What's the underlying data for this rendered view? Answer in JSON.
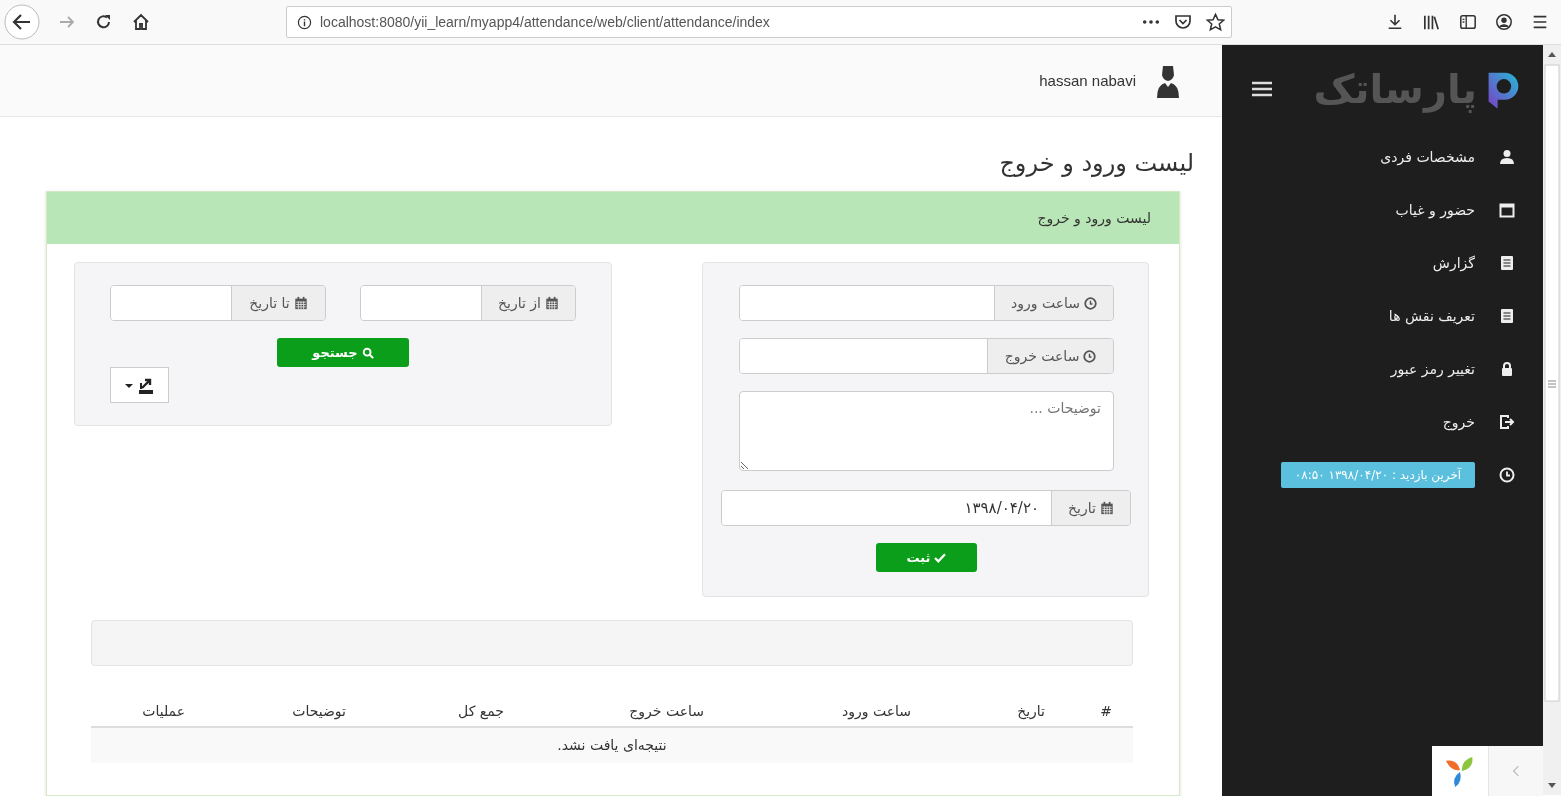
{
  "browser": {
    "url": "localhost:8080/yii_learn/myapp4/attendance/web/client/attendance/index"
  },
  "header": {
    "user_name": "hassan nabavi"
  },
  "page_title": "لیست ورود و خروج",
  "panel": {
    "title": "لیست ورود و خروج",
    "entry_form": {
      "fields": [
        {
          "kind": "time",
          "label": "ساعت ورود"
        },
        {
          "kind": "time",
          "label": "ساعت خروج"
        },
        {
          "kind": "textarea",
          "placeholder": "توضیحات ..."
        },
        {
          "kind": "date",
          "label": "تاریخ",
          "value": "۱۳۹۸/۰۴/۲۰"
        }
      ],
      "button": "ثبت"
    },
    "search_form": {
      "fields": [
        {
          "kind": "date",
          "label": "از تاریخ"
        },
        {
          "kind": "date",
          "label": "تا تاریخ"
        }
      ],
      "button": "جستجو"
    },
    "table": {
      "columns": [
        "#",
        "تاریخ",
        "ساعت ورود",
        "ساعت خروج",
        "جمع کل",
        "توضیحات",
        "عملیات"
      ],
      "empty_message": "نتیجه‌ای یافت نشد."
    }
  },
  "sidebar": {
    "logo_text": "پارساتک",
    "items": [
      {
        "kind": "link",
        "label": "مشخصات فردی"
      },
      {
        "kind": "link",
        "label": "حضور و غیاب"
      },
      {
        "kind": "link",
        "label": "گزارش"
      },
      {
        "kind": "link",
        "label": "تعریف نقش ها"
      },
      {
        "kind": "link",
        "label": "تغییر رمز عبور"
      },
      {
        "kind": "link",
        "label": "خروج"
      },
      {
        "kind": "badge",
        "label": "آخرین بازدید : ۱۳۹۸/۰۴/۲۰ ۰۸:۵۰"
      }
    ]
  }
}
